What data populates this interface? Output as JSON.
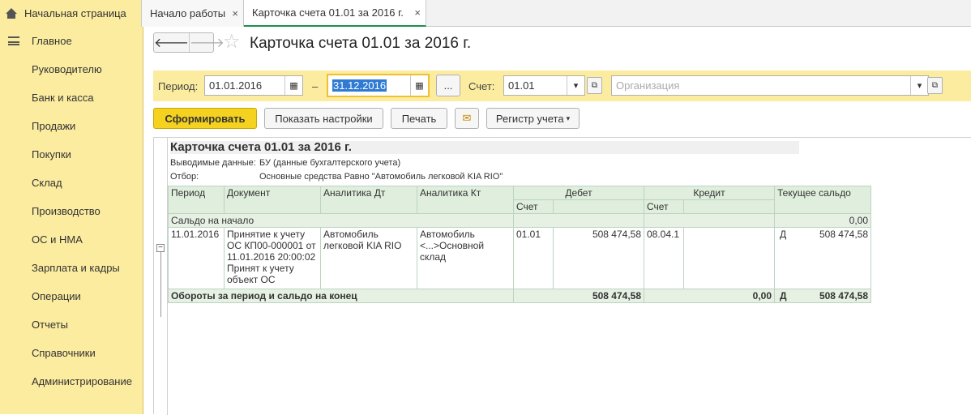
{
  "tabs": [
    {
      "label": "Начальная страница"
    },
    {
      "label": "Начало работы",
      "close": "×"
    },
    {
      "label": "Карточка счета 01.01 за 2016 г.",
      "close": "×"
    }
  ],
  "sidebar": {
    "items": [
      {
        "label": "Главное"
      },
      {
        "label": "Руководителю"
      },
      {
        "label": "Банк и касса"
      },
      {
        "label": "Продажи"
      },
      {
        "label": "Покупки"
      },
      {
        "label": "Склад"
      },
      {
        "label": "Производство"
      },
      {
        "label": "ОС и НМА"
      },
      {
        "label": "Зарплата и кадры"
      },
      {
        "label": "Операции"
      },
      {
        "label": "Отчеты"
      },
      {
        "label": "Справочники"
      },
      {
        "label": "Администрирование"
      }
    ]
  },
  "header": {
    "title": "Карточка счета 01.01 за 2016 г.",
    "back": "🡐",
    "forward": "🡒",
    "star": "☆"
  },
  "filter": {
    "period_label": "Период:",
    "date_from": "01.01.2016",
    "dash": "–",
    "date_to": "31.12.2016",
    "dots": "...",
    "account_label": "Счет:",
    "account": "01.01",
    "org_placeholder": "Организация"
  },
  "toolbar": {
    "generate": "Сформировать",
    "settings": "Показать настройки",
    "print": "Печать",
    "register": "Регистр учета"
  },
  "report": {
    "title": "Карточка счета 01.01 за 2016 г.",
    "meta": [
      {
        "label": "Выводимые данные:",
        "value": "БУ (данные бухгалтерского учета)"
      },
      {
        "label": "Отбор:",
        "value": "Основные средства Равно \"Автомобиль легковой KIA RIO\""
      }
    ],
    "columns": {
      "period": "Период",
      "document": "Документ",
      "an_dt": "Аналитика Дт",
      "an_kt": "Аналитика Кт",
      "debit": "Дебет",
      "credit": "Кредит",
      "balance": "Текущее сальдо",
      "account": "Счет"
    },
    "opening": {
      "label": "Сальдо на начало",
      "value": "0,00"
    },
    "rows": [
      {
        "period": "11.01.2016",
        "document": "Принятие к учету ОС КП00-000001 от 11.01.2016 20:00:02 Принят к учету объект ОС",
        "an_dt": "Автомобиль легковой KIA RIO",
        "an_kt": "Автомобиль <...>Основной склад",
        "debit_account": "01.01",
        "debit_sum": "508 474,58",
        "credit_account": "08.04.1",
        "credit_sum": "",
        "balance_side": "Д",
        "balance_sum": "508 474,58"
      }
    ],
    "totals": {
      "label": "Обороты за период и сальдо на конец",
      "debit": "508 474,58",
      "credit": "0,00",
      "side": "Д",
      "balance": "508 474,58"
    }
  }
}
